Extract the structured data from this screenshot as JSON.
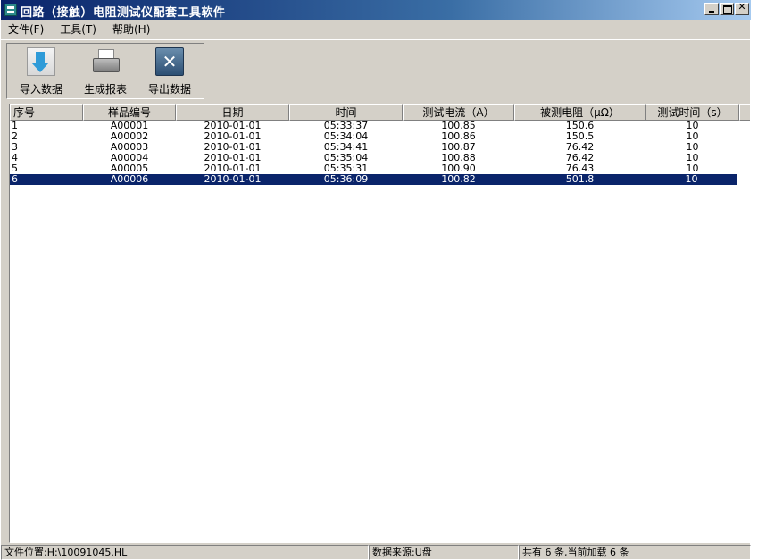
{
  "window": {
    "title": "回路（接触）电阻测试仪配套工具软件",
    "controls": [
      "minimize",
      "maximize",
      "close"
    ]
  },
  "menu": {
    "items": [
      {
        "label": "文件(F)"
      },
      {
        "label": "工具(T)"
      },
      {
        "label": "帮助(H)"
      }
    ]
  },
  "toolbar": {
    "buttons": [
      {
        "label": "导入数据",
        "icon": "import-icon"
      },
      {
        "label": "生成报表",
        "icon": "printer-icon"
      },
      {
        "label": "导出数据",
        "icon": "export-icon"
      }
    ]
  },
  "table": {
    "columns": [
      "序号",
      "样品编号",
      "日期",
      "时间",
      "测试电流（A）",
      "被测电阻（μΩ）",
      "测试时间（s）"
    ],
    "rows": [
      [
        "1",
        "A00001",
        "2010-01-01",
        "05:33:37",
        "100.85",
        "150.6",
        "10"
      ],
      [
        "2",
        "A00002",
        "2010-01-01",
        "05:34:04",
        "100.86",
        "150.5",
        "10"
      ],
      [
        "3",
        "A00003",
        "2010-01-01",
        "05:34:41",
        "100.87",
        "76.42",
        "10"
      ],
      [
        "4",
        "A00004",
        "2010-01-01",
        "05:35:04",
        "100.88",
        "76.42",
        "10"
      ],
      [
        "5",
        "A00005",
        "2010-01-01",
        "05:35:31",
        "100.90",
        "76.43",
        "10"
      ],
      [
        "6",
        "A00006",
        "2010-01-01",
        "05:36:09",
        "100.82",
        "501.8",
        "10"
      ]
    ],
    "selected_row": 5,
    "selection_color": "#0a246a"
  },
  "status": {
    "file_location": "文件位置:H:\\10091045.HL",
    "data_source": "数据来源:U盘",
    "record_count": "共有 6 条,当前加载 6 条"
  },
  "colors": {
    "title_gradient_start": "#0a246a",
    "title_gradient_end": "#a6caf0",
    "face": "#d4d0c8"
  }
}
